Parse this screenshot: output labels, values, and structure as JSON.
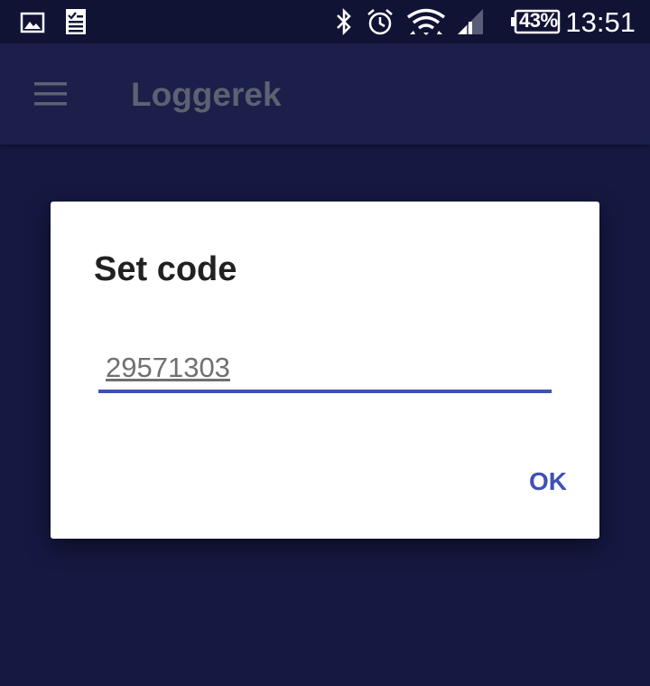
{
  "status_bar": {
    "left_icons": [
      "image-icon",
      "checklist-icon"
    ],
    "right_icons": [
      "bluetooth-icon",
      "alarm-icon",
      "wifi-icon",
      "signal-icon",
      "battery-icon"
    ],
    "battery_percent": "43%",
    "time": "13:51"
  },
  "app_bar": {
    "menu_icon": "hamburger-menu-icon",
    "title": "Loggerek"
  },
  "dialog": {
    "title": "Set code",
    "code_value": "29571303",
    "ok_label": "OK"
  },
  "colors": {
    "background": "#151841",
    "status_bar": "#101334",
    "app_bar": "#1b1f4a",
    "accent": "#3f51b5",
    "dialog_bg": "#ffffff",
    "title_text": "#5e6170"
  }
}
